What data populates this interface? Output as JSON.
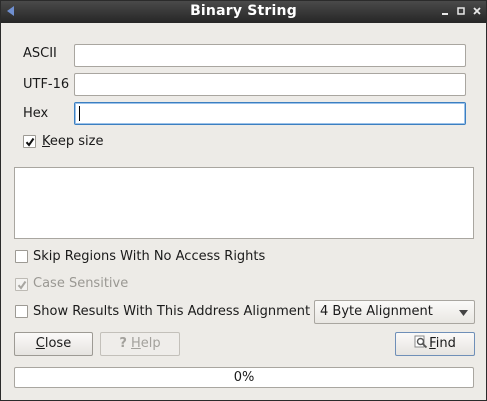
{
  "window": {
    "title": "Binary String",
    "controls": [
      "minimize",
      "maximize",
      "close"
    ]
  },
  "fields": {
    "ascii": {
      "label": "ASCII",
      "value": ""
    },
    "utf16": {
      "label": "UTF-16",
      "value": ""
    },
    "hex": {
      "label": "Hex",
      "value": ""
    }
  },
  "keep_size": {
    "label_prefix": "",
    "label_accel": "K",
    "label_rest": "eep size",
    "checked": true
  },
  "options": {
    "skip_regions": {
      "label": "Skip Regions With No Access Rights",
      "checked": false
    },
    "case_sensitive": {
      "label": "Case Sensitive",
      "checked": true,
      "disabled": true
    },
    "alignment": {
      "label": "Show Results With This Address Alignment",
      "checked": false,
      "selected": "4 Byte Alignment"
    }
  },
  "buttons": {
    "close": {
      "accel": "C",
      "rest": "lose"
    },
    "help": {
      "icon": "?",
      "accel": "H",
      "rest": "elp"
    },
    "find": {
      "accel": "F",
      "rest": "ind"
    }
  },
  "progress": {
    "value": 0,
    "label": "0%"
  },
  "colors": {
    "titlebar": "#262626",
    "focus": "#3c7fc0",
    "window_bg": "#edebe7"
  }
}
